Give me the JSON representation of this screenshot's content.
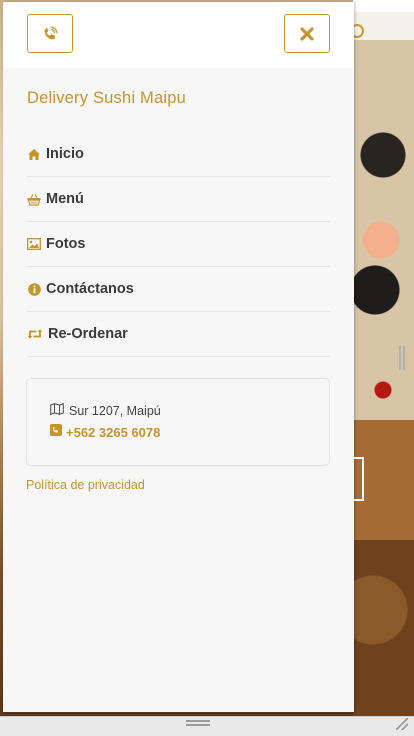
{
  "brand_title": "Delivery Sushi Maipu",
  "nav": [
    {
      "label": "Inicio",
      "icon": "home-icon"
    },
    {
      "label": "Menú",
      "icon": "basket-icon"
    },
    {
      "label": "Fotos",
      "icon": "image-icon"
    },
    {
      "label": "Contáctanos",
      "icon": "info-icon"
    },
    {
      "label": "Re-Ordenar",
      "icon": "retweet-icon"
    }
  ],
  "contact": {
    "address": "Sur 1207, Maipú",
    "phone": "+562 3265 6078"
  },
  "privacy_link": "Política de privacidad",
  "colors": {
    "accent": "#c4952b",
    "text": "#3a3a3a",
    "drawer_bg": "#f7f7f7"
  }
}
